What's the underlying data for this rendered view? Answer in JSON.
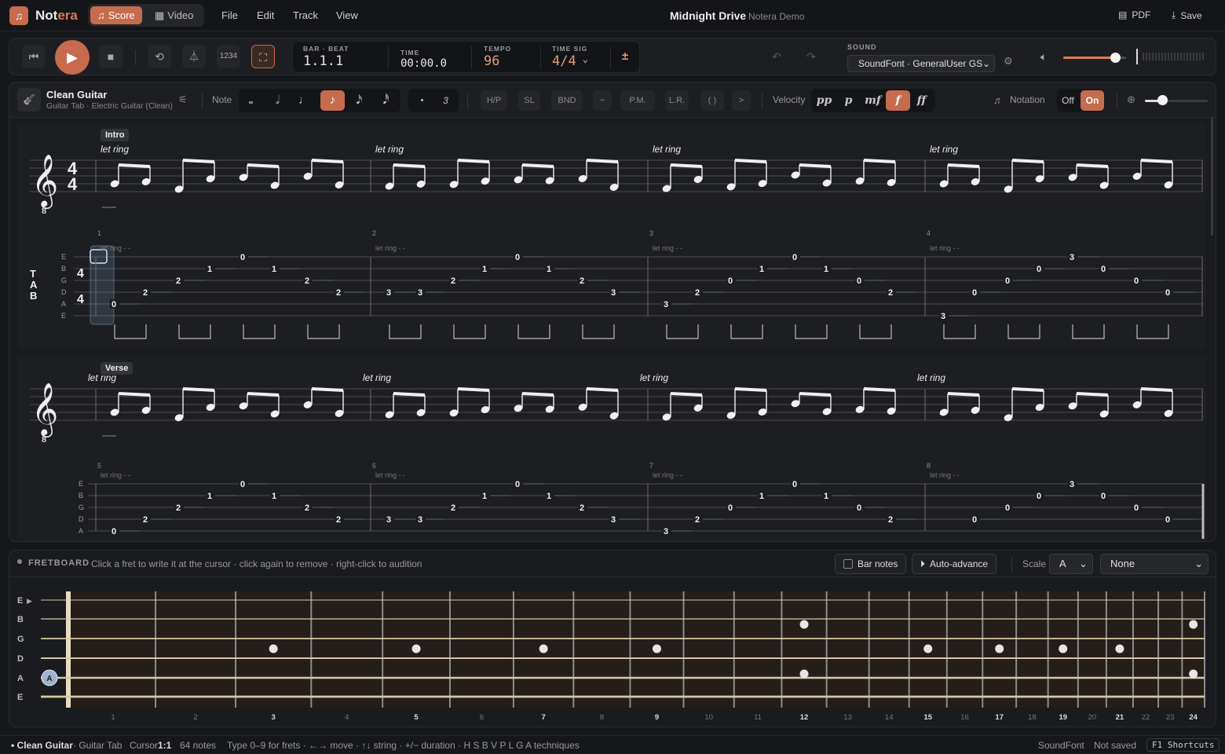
{
  "app": {
    "name_a": "Not",
    "name_b": "era",
    "logo_icon": "music-note-icon",
    "accent": "#c76a4d"
  },
  "header": {
    "modes": [
      {
        "label": "Score",
        "icon": "music-note-icon",
        "active": true
      },
      {
        "label": "Video",
        "icon": "film-icon",
        "active": false
      }
    ],
    "menu": [
      "File",
      "Edit",
      "Track",
      "View"
    ],
    "doc_title": "Midnight Drive",
    "doc_subtitle": "Notera Demo",
    "pdf_label": "PDF",
    "save_label": "Save"
  },
  "transport": {
    "count_in": "1234",
    "bar_beat_label": "BAR · BEAT",
    "bar_beat": "1.1.1",
    "time_label": "TIME",
    "time": "00:00.0",
    "tempo_label": "TEMPO",
    "tempo": "96",
    "timesig_label": "TIME SIG",
    "timesig": "4/4",
    "transpose": "±",
    "sound_label": "SOUND",
    "soundfont": "SoundFont · GeneralUser GS",
    "volume": 0.8
  },
  "toolbar": {
    "track_name": "Clean Guitar",
    "track_sub": "Guitar Tab · Electric Guitar (Clean)",
    "note_label": "Note",
    "durations": [
      "𝅝",
      "𝅗𝅥",
      "♩",
      "♪",
      "𝅘𝅥𝅯",
      "𝅘𝅥𝅰"
    ],
    "active_duration": 3,
    "dot": "•",
    "triplet": "3",
    "techniques": [
      "H/P",
      "SL",
      "BND",
      "~",
      "P.M.",
      "L.R.",
      "( )",
      ">"
    ],
    "velocity_label": "Velocity",
    "velocities": [
      "pp",
      "p",
      "mf",
      "f",
      "ff"
    ],
    "active_velocity": 3,
    "notation_label": "Notation",
    "notation_off": "Off",
    "notation_on": "On",
    "zoom": 0.25
  },
  "score": {
    "clef_octave": "8",
    "time_sig": [
      "4",
      "4"
    ],
    "tab_letters": [
      "T",
      "A",
      "B"
    ],
    "tab_sig": [
      "4",
      "4"
    ],
    "let_ring": "let ring",
    "let_ring_tab": "let ring - -",
    "strings": [
      "E",
      "B",
      "G",
      "D",
      "A",
      "E"
    ],
    "systems": [
      {
        "section": "Intro",
        "bars": [
          "1",
          "2",
          "3",
          "4"
        ]
      },
      {
        "section": "Verse",
        "bars": [
          "5",
          "6",
          "7",
          "8"
        ]
      }
    ],
    "tab_bars": [
      [
        {
          "s": 4,
          "f": "0"
        },
        {
          "s": 3,
          "f": "2"
        },
        {
          "s": 2,
          "f": "2"
        },
        {
          "s": 1,
          "f": "1"
        },
        {
          "s": 0,
          "f": "0"
        },
        {
          "s": 1,
          "f": "1"
        },
        {
          "s": 2,
          "f": "2"
        },
        {
          "s": 3,
          "f": "2"
        }
      ],
      [
        {
          "s": 3,
          "f": "3"
        },
        {
          "s": 3,
          "f": "3"
        },
        {
          "s": 2,
          "f": "2"
        },
        {
          "s": 1,
          "f": "1"
        },
        {
          "s": 0,
          "f": "0"
        },
        {
          "s": 1,
          "f": "1"
        },
        {
          "s": 2,
          "f": "2"
        },
        {
          "s": 3,
          "f": "3"
        }
      ],
      [
        {
          "s": 4,
          "f": "3"
        },
        {
          "s": 3,
          "f": "2"
        },
        {
          "s": 2,
          "f": "0"
        },
        {
          "s": 1,
          "f": "1"
        },
        {
          "s": 0,
          "f": "0"
        },
        {
          "s": 1,
          "f": "1"
        },
        {
          "s": 2,
          "f": "0"
        },
        {
          "s": 3,
          "f": "2"
        }
      ],
      [
        {
          "s": 5,
          "f": "3"
        },
        {
          "s": 3,
          "f": "0"
        },
        {
          "s": 2,
          "f": "0"
        },
        {
          "s": 1,
          "f": "0"
        },
        {
          "s": 0,
          "f": "3"
        },
        {
          "s": 1,
          "f": "0"
        },
        {
          "s": 2,
          "f": "0"
        },
        {
          "s": 3,
          "f": "0"
        }
      ]
    ]
  },
  "fretboard": {
    "title": "FRETBOARD",
    "hint": "Click a fret to write it at the cursor · click again to remove · right-click to audition",
    "bar_notes": "Bar notes",
    "auto_advance": "Auto-advance",
    "scale_label": "Scale",
    "scale_root": "A",
    "scale_type": "None",
    "strings": [
      "E",
      "B",
      "G",
      "D",
      "A",
      "E"
    ],
    "fret_numbers": [
      "1",
      "2",
      "3",
      "4",
      "5",
      "6",
      "7",
      "8",
      "9",
      "10",
      "11",
      "12",
      "13",
      "14",
      "15",
      "16",
      "17",
      "18",
      "19",
      "20",
      "21",
      "22",
      "23",
      "24"
    ],
    "open_marker": "A"
  },
  "status": {
    "track": "• Clean Guitar",
    "track_type": "· Guitar Tab",
    "cursor_label": "Cursor",
    "cursor": "1:1",
    "notes": "64 notes",
    "help": "Type 0–9 for frets · ←→ move · ↑↓ string · +/− duration · H S B V P L G A techniques",
    "engine": "SoundFont",
    "saved": "Not saved",
    "shortcuts": "F1 Shortcuts"
  }
}
